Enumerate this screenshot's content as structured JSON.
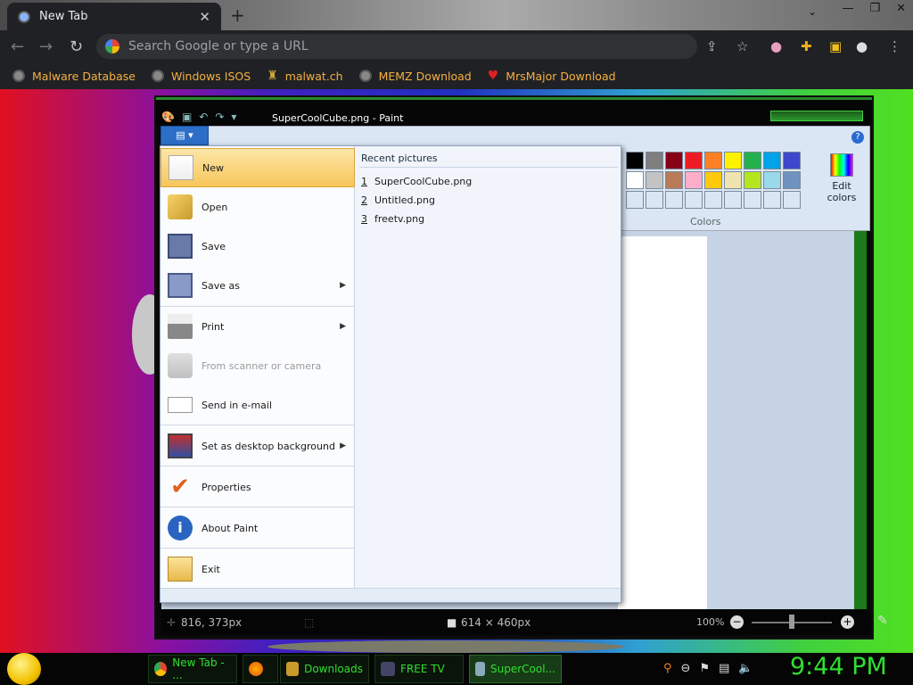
{
  "browser": {
    "tab_title": "New Tab",
    "tab_close": "✕",
    "new_tab": "+",
    "omnibox_placeholder": "Search Google or type a URL",
    "bookmarks": [
      {
        "label": "Malware Database",
        "icon": "globe-icon"
      },
      {
        "label": "Windows ISOS",
        "icon": "globe-icon"
      },
      {
        "label": "malwat.ch",
        "icon": "urn-icon"
      },
      {
        "label": "MEMZ Download",
        "icon": "globe-icon"
      },
      {
        "label": "MrsMajor Download",
        "icon": "heart-icon"
      }
    ]
  },
  "paint": {
    "window_title": "SuperCoolCube.png - Paint",
    "help": "?",
    "edit_colors_line1": "Edit",
    "edit_colors_line2": "colors",
    "colors_group": "Colors",
    "palette": [
      "#000000",
      "#7f7f7f",
      "#880015",
      "#ed1c24",
      "#ff7f27",
      "#fff200",
      "#22b14c",
      "#00a2e8",
      "#3f48cc",
      "#ffffff",
      "#c3c3c3",
      "#b97a57",
      "#ffaec9",
      "#ffc90e",
      "#efe4b0",
      "#b5e61d",
      "#99d9ea",
      "#7092be",
      "#dbe6f4",
      "#dbe6f4",
      "#dbe6f4",
      "#dbe6f4",
      "#dbe6f4",
      "#dbe6f4",
      "#dbe6f4",
      "#dbe6f4",
      "#dbe6f4"
    ],
    "extra_color": "#a349a4",
    "status": {
      "cursor_pos": "816, 373px",
      "image_size": "614 × 460px",
      "zoom": "100%"
    }
  },
  "app_menu": {
    "button_label": "▤ ▾",
    "items": [
      {
        "label": "New",
        "icon": "new-file-icon",
        "has_submenu": false,
        "disabled": false
      },
      {
        "label": "Open",
        "icon": "open-folder-icon",
        "has_submenu": false,
        "disabled": false
      },
      {
        "label": "Save",
        "icon": "save-disk-icon",
        "has_submenu": false,
        "disabled": false
      },
      {
        "label": "Save as",
        "icon": "save-as-icon",
        "has_submenu": true,
        "disabled": false
      },
      {
        "label": "Print",
        "icon": "printer-icon",
        "has_submenu": true,
        "disabled": false
      },
      {
        "label": "From scanner or camera",
        "icon": "scanner-icon",
        "has_submenu": false,
        "disabled": true
      },
      {
        "label": "Send in e-mail",
        "icon": "email-icon",
        "has_submenu": false,
        "disabled": false
      },
      {
        "label": "Set as desktop background",
        "icon": "desktop-background-icon",
        "has_submenu": true,
        "disabled": false
      },
      {
        "label": "Properties",
        "icon": "checkmark-icon",
        "has_submenu": false,
        "disabled": false
      },
      {
        "label": "About Paint",
        "icon": "info-icon",
        "has_submenu": false,
        "disabled": false
      },
      {
        "label": "Exit",
        "icon": "exit-icon",
        "has_submenu": false,
        "disabled": false
      }
    ],
    "recent_title": "Recent pictures",
    "recent": [
      {
        "num": "1",
        "name": "SuperCoolCube.png"
      },
      {
        "num": "2",
        "name": "Untitled.png"
      },
      {
        "num": "3",
        "name": "freetv.png"
      }
    ]
  },
  "taskbar": {
    "buttons": [
      {
        "label": "New Tab - ...",
        "icon": "chrome-icon"
      },
      {
        "label": "",
        "icon": "firefox-icon"
      },
      {
        "label": "Downloads",
        "icon": "folder-icon"
      },
      {
        "label": "FREE TV",
        "icon": "tv-icon"
      },
      {
        "label": "SuperCool...",
        "icon": "paint-icon"
      }
    ],
    "clock": "9:44 PM"
  }
}
